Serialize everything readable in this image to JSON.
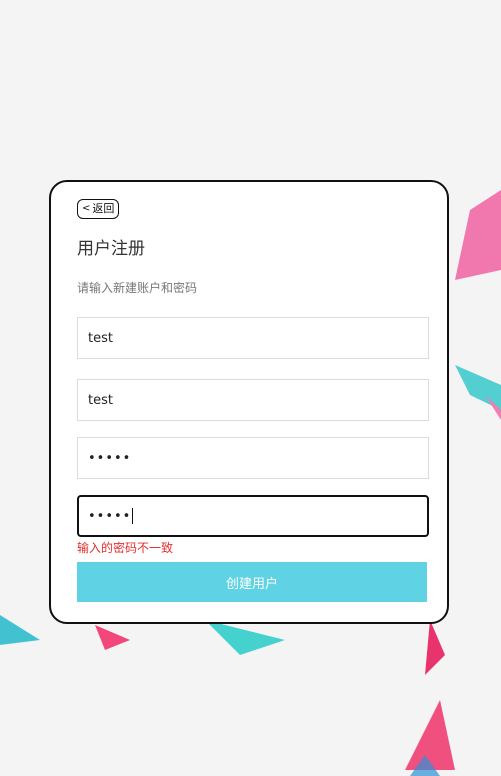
{
  "back_label": "返回",
  "title": "用户注册",
  "subtitle": "请输入新建账户和密码",
  "fields": [
    {
      "value": "test"
    },
    {
      "value": "test"
    },
    {
      "value": "•••••"
    },
    {
      "value": "•••••"
    }
  ],
  "error": "输入的密码不一致",
  "submit_label": "创建用户",
  "colors": {
    "accent": "#5fd3e3",
    "error": "#e03030"
  }
}
